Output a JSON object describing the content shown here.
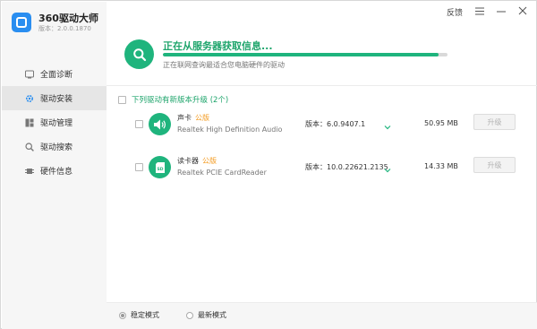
{
  "app": {
    "title": "360驱动大师",
    "version": "版本：2.0.0.1870"
  },
  "window_controls": {
    "feedback": "反馈",
    "menu_icon": "menu-icon",
    "minimize_icon": "minimize-icon",
    "close_icon": "close-icon"
  },
  "sidebar": {
    "items": [
      {
        "label": "全面诊断",
        "icon": "diagnose-icon",
        "active": false
      },
      {
        "label": "驱动安装",
        "icon": "gear-icon",
        "active": true
      },
      {
        "label": "驱动管理",
        "icon": "grid-icon",
        "active": false
      },
      {
        "label": "驱动搜索",
        "icon": "search-icon",
        "active": false
      },
      {
        "label": "硬件信息",
        "icon": "chip-icon",
        "active": false
      }
    ]
  },
  "status": {
    "title": "正在从服务器获取信息...",
    "subtitle": "正在联网查询最适合您电脑硬件的驱动",
    "progress": 0.97,
    "accent_color": "#1fb47d"
  },
  "list": {
    "header": "下列驱动有新版本升级 (2个)",
    "drivers": [
      {
        "name": "声卡",
        "tag": "公版",
        "description": "Realtek High Definition Audio",
        "version": "版本：6.0.9407.1",
        "size": "50.95 MB",
        "button": "升级",
        "icon": "speaker-icon"
      },
      {
        "name": "读卡器",
        "tag": "公版",
        "description": "Realtek PCIE CardReader",
        "version": "版本：10.0.22621.2135",
        "size": "14.33 MB",
        "button": "升级",
        "icon": "sd-card-icon"
      }
    ]
  },
  "mode": {
    "stable": "稳定模式",
    "latest": "最新模式",
    "selected": "stable"
  }
}
